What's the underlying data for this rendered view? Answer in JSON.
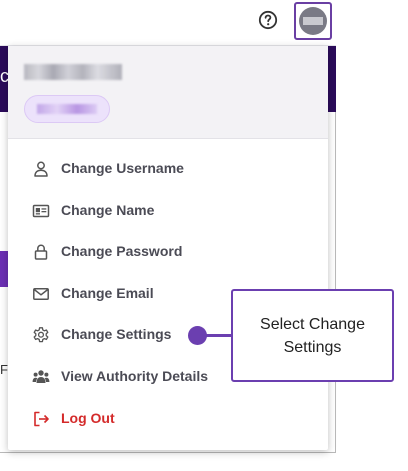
{
  "header": {
    "help_icon": "question-circle-icon",
    "avatar_icon": "user-avatar-icon",
    "edge_text": "c"
  },
  "sidebar": {
    "edge_letter": "F"
  },
  "dropdown": {
    "items": [
      {
        "label": "Change Username",
        "icon": "user-icon"
      },
      {
        "label": "Change Name",
        "icon": "id-card-icon"
      },
      {
        "label": "Change Password",
        "icon": "lock-icon"
      },
      {
        "label": "Change Email",
        "icon": "envelope-icon"
      },
      {
        "label": "Change Settings",
        "icon": "gear-icon"
      },
      {
        "label": "View Authority Details",
        "icon": "users-icon"
      },
      {
        "label": "Log Out",
        "icon": "logout-icon"
      }
    ]
  },
  "callout": {
    "text": "Select Change Settings"
  },
  "colors": {
    "accent": "#6b3fb0",
    "band": "#2b0b5a",
    "logout": "#d42a2a"
  }
}
